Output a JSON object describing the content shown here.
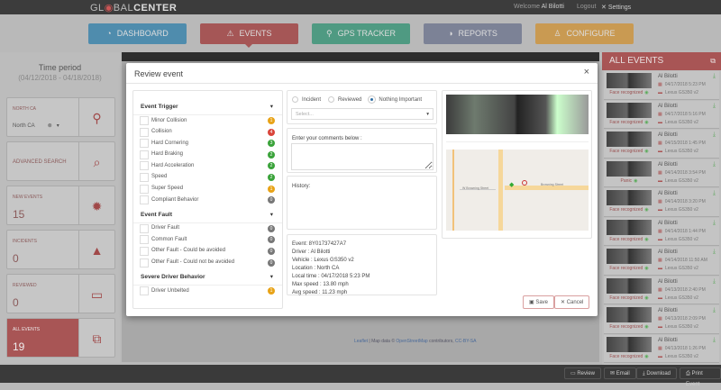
{
  "topbar": {
    "logo_prefix": "GL",
    "logo_mid": "BAL",
    "logo_bold": "CENTER",
    "welcome": "Welcome",
    "user": "Al Bilotti",
    "logout": "Logout",
    "settings": "Settings"
  },
  "nav": [
    {
      "label": "DASHBOARD",
      "color": "#4f8cad"
    },
    {
      "label": "EVENTS",
      "color": "#a55656"
    },
    {
      "label": "GPS TRACKER",
      "color": "#4f9a82"
    },
    {
      "label": "REPORTS",
      "color": "#7c8296"
    },
    {
      "label": "CONFIGURE",
      "color": "#c99a52"
    }
  ],
  "sidebar": {
    "time_period": "Time period",
    "date_range": "(04/12/2018 - 04/18/2018)",
    "region_label": "NORTH CA",
    "region_value": "North CA",
    "advanced_search": "ADVANCED SEARCH",
    "new_events_label": "NEW EVENTS",
    "new_events": "15",
    "incidents_label": "INCIDENTS",
    "incidents": "0",
    "reviewed_label": "REVIEWED",
    "reviewed": "0",
    "all_events_label": "ALL EVENTS",
    "all_events": "19"
  },
  "map_attribution": {
    "leaflet": "Leaflet",
    "text": " | Map data © ",
    "osm": "OpenStreetMap",
    "contrib": " contributors, ",
    "license": "CC-BY-SA"
  },
  "modal": {
    "title": "Review event",
    "close": "×",
    "sections": [
      {
        "title": "Event Trigger",
        "items": [
          {
            "label": "Minor Collision",
            "count": "1",
            "color": "#e8a317"
          },
          {
            "label": "Collision",
            "count": "4",
            "color": "#d9443a"
          },
          {
            "label": "Hard Cornering",
            "count": "3",
            "color": "#3aa33a"
          },
          {
            "label": "Hard Braking",
            "count": "2",
            "color": "#3aa33a"
          },
          {
            "label": "Hard Acceleration",
            "count": "2",
            "color": "#3aa33a"
          },
          {
            "label": "Speed",
            "count": "2",
            "color": "#3aa33a"
          },
          {
            "label": "Super Speed",
            "count": "1",
            "color": "#e8a317"
          },
          {
            "label": "Compliant Behavior",
            "count": "0",
            "color": "#777777"
          }
        ]
      },
      {
        "title": "Event Fault",
        "items": [
          {
            "label": "Driver Fault",
            "count": "0",
            "color": "#777777"
          },
          {
            "label": "Common Fault",
            "count": "0",
            "color": "#777777"
          },
          {
            "label": "Other Fault - Could be avoided",
            "count": "0",
            "color": "#777777"
          },
          {
            "label": "Other Fault - Could not be avoided",
            "count": "0",
            "color": "#777777"
          }
        ]
      },
      {
        "title": "Severe Driver Behavior",
        "items": [
          {
            "label": "Driver Unbelted",
            "count": "1",
            "color": "#e8a317"
          }
        ]
      }
    ],
    "status_options": [
      {
        "label": "Incident",
        "checked": false
      },
      {
        "label": "Reviewed",
        "checked": false
      },
      {
        "label": "Nothing Important",
        "checked": true
      }
    ],
    "select_placeholder": "Select...",
    "comments_label": "Enter your comments below :",
    "history_label": "History:",
    "event_info": [
      "Event: 8Y01737427A7",
      "Driver : Al Bilotti",
      "Vehicle : Lexus GS350 v2",
      "Location : North CA",
      "Local time : 04/17/2018 5:23 PM",
      "Max speed : 13.80 mph",
      "Avg speed : 11.23 mph"
    ],
    "map_streets": [
      "Browning Street",
      "W Browning Street"
    ],
    "save": "Save",
    "cancel": "Cancel"
  },
  "all_events": {
    "title": "ALL EVENTS",
    "items": [
      {
        "name": "Al Bilotti",
        "time": "04/17/2018 5:23 PM",
        "vehicle": "Lexus GS350 v2",
        "tag": "Face recognized"
      },
      {
        "name": "Al Bilotti",
        "time": "04/17/2018 5:16 PM",
        "vehicle": "Lexus GS350 v2",
        "tag": "Face recognized"
      },
      {
        "name": "Al Bilotti",
        "time": "04/15/2018 1:45 PM",
        "vehicle": "Lexus GS350 v2",
        "tag": "Face recognized"
      },
      {
        "name": "Al Bilotti",
        "time": "04/14/2018 3:54 PM",
        "vehicle": "Lexus GS350 v2",
        "tag": "Panic"
      },
      {
        "name": "Al Bilotti",
        "time": "04/14/2018 3:20 PM",
        "vehicle": "Lexus GS350 v2",
        "tag": "Face recognized"
      },
      {
        "name": "Al Bilotti",
        "time": "04/14/2018 1:44 PM",
        "vehicle": "Lexus GS350 v2",
        "tag": "Face recognized"
      },
      {
        "name": "Al Bilotti",
        "time": "04/14/2018 11:50 AM",
        "vehicle": "Lexus GS350 v2",
        "tag": "Face recognized"
      },
      {
        "name": "Al Bilotti",
        "time": "04/13/2018 2:40 PM",
        "vehicle": "Lexus GS350 v2",
        "tag": "Face recognized"
      },
      {
        "name": "Al Bilotti",
        "time": "04/13/2018 2:09 PM",
        "vehicle": "Lexus GS350 v2",
        "tag": "Face recognized"
      },
      {
        "name": "Al Bilotti",
        "time": "04/13/2018 1:26 PM",
        "vehicle": "Lexus GS350 v2",
        "tag": "Face recognized"
      },
      {
        "name": "Al Bilotti",
        "time": "",
        "vehicle": "",
        "tag": ""
      }
    ]
  },
  "bottom": {
    "review": "Review",
    "email": "Email",
    "download": "Download",
    "print": "Print Event"
  }
}
